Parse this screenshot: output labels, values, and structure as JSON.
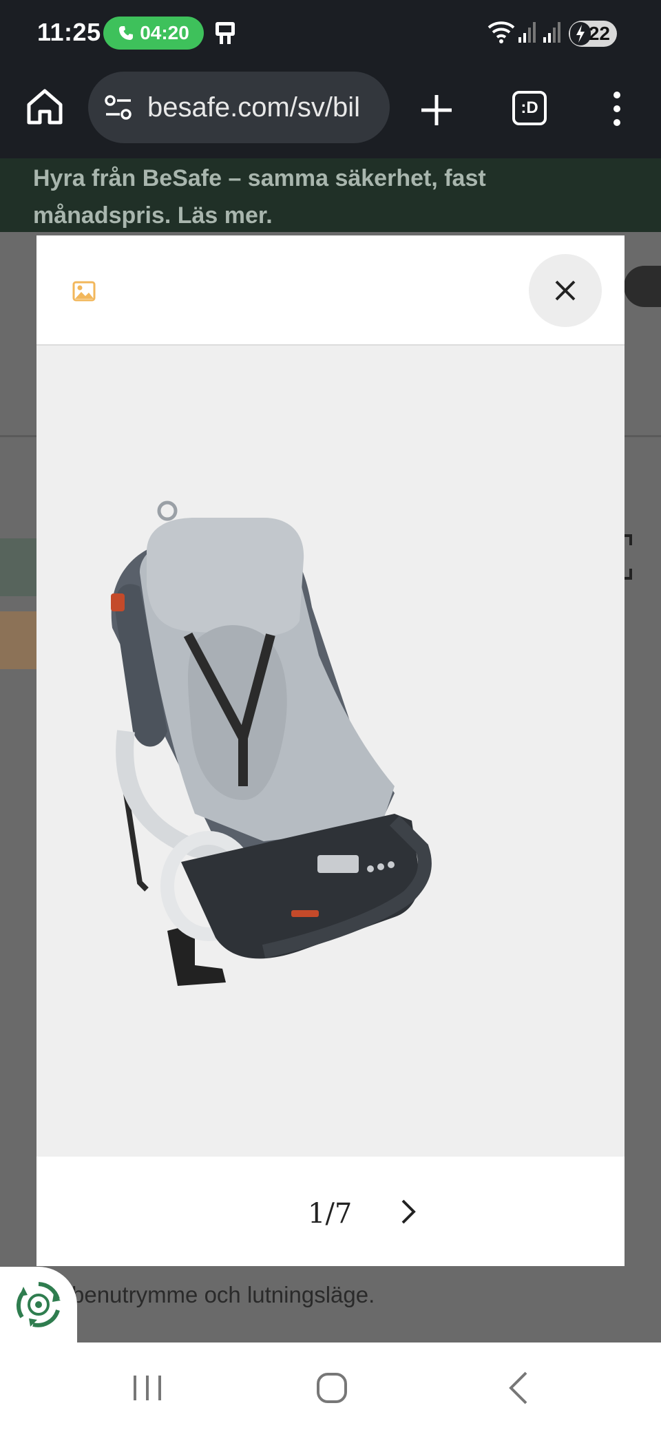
{
  "status_bar": {
    "time": "11:25",
    "call_timer": "04:20",
    "battery_level": "22",
    "icons": [
      "call-icon",
      "device-icon",
      "wifi-icon",
      "signal-icon",
      "signal-icon",
      "battery-icon"
    ]
  },
  "browser": {
    "url": "besafe.com/sv/bil",
    "tabs_label": ":D",
    "icons": [
      "home-icon",
      "site-settings-icon",
      "plus-icon",
      "tabs-icon",
      "more-vert-icon"
    ]
  },
  "page": {
    "promo_banner": "Hyra från BeSafe – samma säkerhet, fast månadspris. Läs mer.",
    "body_text": "benutrymme och lutningsläge."
  },
  "modal": {
    "pager": "1/7",
    "icons": [
      "image-icon",
      "close-icon",
      "chevron-right-icon"
    ],
    "image_subject": "car-seat-product-photo"
  },
  "nav_bar": {
    "icons": [
      "recents-icon",
      "home-icon",
      "back-icon"
    ]
  },
  "colors": {
    "status_bg": "#1b1e23",
    "call_green": "#3ec15b",
    "banner_green": "#203027",
    "modal_image_bg": "#efefef",
    "accent_image_icon": "#f2b75b",
    "recycle_green": "#2f7d4f"
  }
}
